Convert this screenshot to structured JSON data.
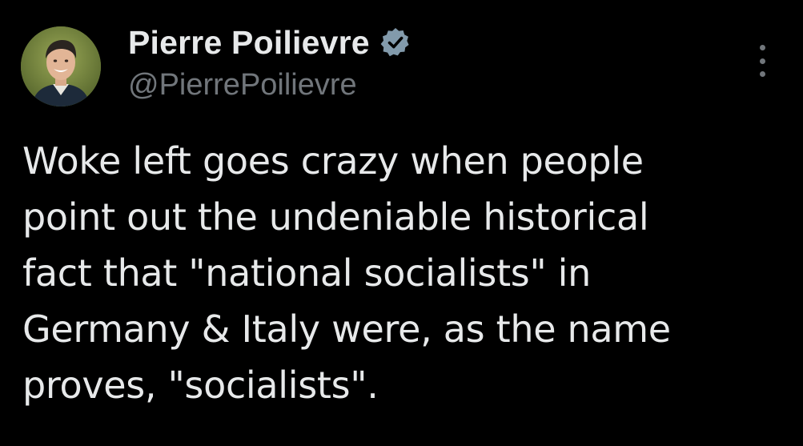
{
  "tweet": {
    "author": {
      "display_name": "Pierre Poilievre",
      "handle": "@PierrePoilievre",
      "verified_icon": "verified-badge-icon",
      "avatar_icon": "profile-photo"
    },
    "more_icon": "more-options-icon",
    "text_lines": [
      "Woke left goes crazy when people",
      "point out the undeniable historical",
      "fact that \"national socialists\" in",
      "Germany & Italy were, as the name",
      "proves, \"socialists\"."
    ]
  },
  "colors": {
    "background": "#000000",
    "primary_text": "#e7e9ea",
    "secondary_text": "#71767b",
    "verified_badge": "#829aab"
  }
}
